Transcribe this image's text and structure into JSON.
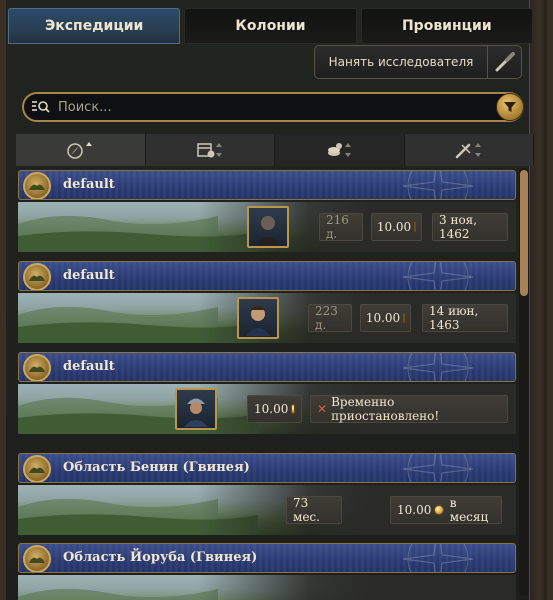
{
  "tabs": [
    {
      "label": "Экспедиции",
      "active": true
    },
    {
      "label": "Колонии",
      "active": false
    },
    {
      "label": "Провинции",
      "active": false
    }
  ],
  "hire_button": {
    "label": "Нанять исследователя",
    "icon": "spyglass-icon"
  },
  "search": {
    "placeholder": "Поиск...",
    "value": "",
    "filter_icon": "funnel-icon"
  },
  "sort_columns": [
    {
      "icon": "compass-sort-icon",
      "active": true
    },
    {
      "icon": "calendar-sort-icon",
      "active": false
    },
    {
      "icon": "coins-sort-icon",
      "active": false
    },
    {
      "icon": "tools-sort-icon",
      "active": false
    }
  ],
  "entries": [
    {
      "name": "default",
      "duration": "216 д.",
      "cost": "10.00",
      "date": "3 ноя, 1462"
    },
    {
      "name": "default",
      "duration": "223 д.",
      "cost": "10.00",
      "date": "14 июн, 1463"
    },
    {
      "name": "default",
      "cost": "10.00",
      "status": "Временно приостановлено!"
    },
    {
      "name": "Область Бенин (Гвинея)",
      "duration": "73 мес.",
      "cost": "10.00",
      "cost_suffix": "в месяц"
    },
    {
      "name": "Область Йоруба (Гвинея)"
    }
  ],
  "colors": {
    "accent_gold": "#a8854a",
    "header_blue": "#2a3a72",
    "tab_active": "#2a4a66",
    "warning_red": "#d55a42"
  }
}
